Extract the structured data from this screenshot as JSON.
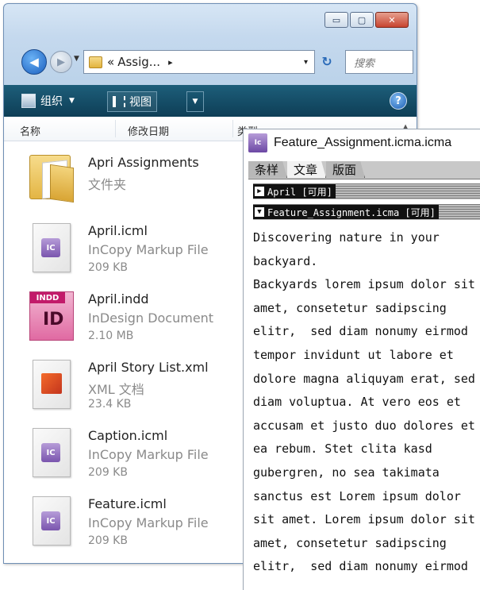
{
  "explorer": {
    "caption_buttons": {
      "minimize": "▭",
      "maximize": "▢",
      "close": "✕"
    },
    "address": {
      "prefix": "«",
      "path": "Assig...",
      "separator": "▸",
      "dropdown": "▾"
    },
    "search_placeholder": "搜索",
    "toolbar": {
      "organize": "组织",
      "view": "视图",
      "help": "?"
    },
    "columns": {
      "name": "名称",
      "date_modified": "修改日期",
      "type": "类型"
    },
    "files": [
      {
        "name": "Apri Assignments",
        "type": "文件夹",
        "size": ""
      },
      {
        "name": "April.icml",
        "type": "InCopy Markup File",
        "size": "209 KB"
      },
      {
        "name": "April.indd",
        "type": "InDesign Document",
        "size": "2.10 MB"
      },
      {
        "name": "April Story List.xml",
        "type": "XML 文档",
        "size": "23.4 KB"
      },
      {
        "name": "Caption.icml",
        "type": "InCopy Markup File",
        "size": "209 KB"
      },
      {
        "name": "Feature.icml",
        "type": "InCopy Markup File",
        "size": "209 KB"
      }
    ],
    "icon_badges": {
      "ic": "IC",
      "indd_tag": "INDD",
      "indd_mark": "ID"
    }
  },
  "incopy": {
    "title": "Feature_Assignment.icma.icma",
    "icon_label": "Ic",
    "tabs": [
      "条样",
      "文章",
      "版面"
    ],
    "active_tab": "文章",
    "stories": [
      {
        "label": "April [可用]",
        "expanded": false
      },
      {
        "label": "Feature_Assignment.icma [可用]",
        "expanded": true
      }
    ],
    "text_lines": [
      "Discovering nature in your",
      "backyard.",
      "Backyards lorem ipsum dolor sit",
      "amet, consetetur sadipscing",
      "elitr,  sed diam nonumy eirmod",
      "tempor invidunt ut labore et",
      "dolore magna aliquyam erat, sed",
      "diam voluptua. At vero eos et",
      "accusam et justo duo dolores et",
      "ea rebum. Stet clita kasd",
      "gubergren, no sea takimata",
      "sanctus est Lorem ipsum dolor",
      "sit amet. Lorem ipsum dolor sit",
      "amet, consetetur sadipscing",
      "elitr,  sed diam nonumy eirmod"
    ]
  }
}
